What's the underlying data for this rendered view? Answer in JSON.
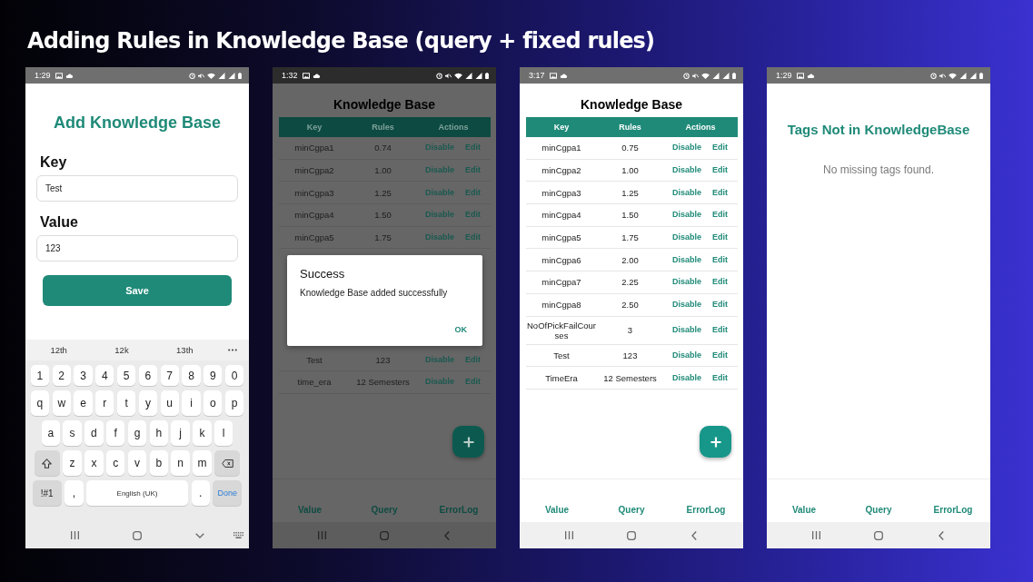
{
  "title": "Adding Rules in Knowledge Base (query + fixed rules)",
  "phones": [
    {
      "kind": "form",
      "status_bar": {
        "time": "1:29"
      },
      "heading": "Add Knowledge Base",
      "fields": [
        {
          "label": "Key",
          "value": "Test"
        },
        {
          "label": "Value",
          "value": "123"
        }
      ],
      "save_button": "Save",
      "keyboard": {
        "suggestions": [
          "12th",
          "12k",
          "13th"
        ],
        "rows": [
          {
            "keys": [
              {
                "kind": "char",
                "label": "1"
              },
              {
                "kind": "char",
                "label": "2"
              },
              {
                "kind": "char",
                "label": "3"
              },
              {
                "kind": "char",
                "label": "4"
              },
              {
                "kind": "char",
                "label": "5"
              },
              {
                "kind": "char",
                "label": "6"
              },
              {
                "kind": "char",
                "label": "7"
              },
              {
                "kind": "char",
                "label": "8"
              },
              {
                "kind": "char",
                "label": "9"
              },
              {
                "kind": "char",
                "label": "0"
              }
            ]
          },
          {
            "keys": [
              {
                "kind": "char",
                "label": "q"
              },
              {
                "kind": "char",
                "label": "w"
              },
              {
                "kind": "char",
                "label": "e"
              },
              {
                "kind": "char",
                "label": "r"
              },
              {
                "kind": "char",
                "label": "t"
              },
              {
                "kind": "char",
                "label": "y"
              },
              {
                "kind": "char",
                "label": "u"
              },
              {
                "kind": "char",
                "label": "i"
              },
              {
                "kind": "char",
                "label": "o"
              },
              {
                "kind": "char",
                "label": "p"
              }
            ]
          },
          {
            "keys": [
              {
                "kind": "char",
                "label": "a"
              },
              {
                "kind": "char",
                "label": "s"
              },
              {
                "kind": "char",
                "label": "d"
              },
              {
                "kind": "char",
                "label": "f"
              },
              {
                "kind": "char",
                "label": "g"
              },
              {
                "kind": "char",
                "label": "h"
              },
              {
                "kind": "char",
                "label": "j"
              },
              {
                "kind": "char",
                "label": "k"
              },
              {
                "kind": "char",
                "label": "l"
              }
            ]
          },
          {
            "keys": [
              {
                "kind": "shift"
              },
              {
                "kind": "char",
                "label": "z"
              },
              {
                "kind": "char",
                "label": "x"
              },
              {
                "kind": "char",
                "label": "c"
              },
              {
                "kind": "char",
                "label": "v"
              },
              {
                "kind": "char",
                "label": "b"
              },
              {
                "kind": "char",
                "label": "n"
              },
              {
                "kind": "char",
                "label": "m"
              },
              {
                "kind": "backspace"
              }
            ]
          },
          {
            "keys": [
              {
                "kind": "symbols",
                "label": "!#1"
              },
              {
                "kind": "char",
                "label": ","
              },
              {
                "kind": "space",
                "label": "English (UK)"
              },
              {
                "kind": "char",
                "label": "."
              },
              {
                "kind": "done",
                "label": "Done"
              }
            ]
          }
        ]
      }
    },
    {
      "kind": "table",
      "status_bar": {
        "time": "1:32"
      },
      "heading": "Knowledge Base",
      "table": {
        "columns": [
          "Key",
          "Rules",
          "Actions"
        ],
        "rows": [
          {
            "kind": "row",
            "key": "minCgpa1",
            "rule": "0.74",
            "actions": [
              "Disable",
              "Edit"
            ]
          },
          {
            "kind": "row",
            "key": "minCgpa2",
            "rule": "1.00",
            "actions": [
              "Disable",
              "Edit"
            ]
          },
          {
            "kind": "row",
            "key": "minCgpa3",
            "rule": "1.25",
            "actions": [
              "Disable",
              "Edit"
            ]
          },
          {
            "kind": "row",
            "key": "minCgpa4",
            "rule": "1.50",
            "actions": [
              "Disable",
              "Edit"
            ]
          },
          {
            "kind": "row",
            "key": "minCgpa5",
            "rule": "1.75",
            "actions": [
              "Disable",
              "Edit"
            ]
          },
          {
            "kind": "dialog",
            "title": "Success",
            "message": "Knowledge Base added successfully",
            "button": "OK"
          },
          {
            "kind": "row",
            "key": "Test",
            "rule": "123",
            "actions": [
              "Disable",
              "Edit"
            ]
          },
          {
            "kind": "row",
            "key": "time_era",
            "rule": "12 Semesters",
            "actions": [
              "Disable",
              "Edit"
            ]
          }
        ]
      },
      "bottom_tabs": [
        "Value",
        "Query",
        "ErrorLog"
      ]
    },
    {
      "kind": "table",
      "status_bar": {
        "time": "3:17"
      },
      "heading": "Knowledge Base",
      "table": {
        "columns": [
          "Key",
          "Rules",
          "Actions"
        ],
        "rows": [
          {
            "kind": "row",
            "key": "minCgpa1",
            "rule": "0.75",
            "actions": [
              "Disable",
              "Edit"
            ]
          },
          {
            "kind": "row",
            "key": "minCgpa2",
            "rule": "1.00",
            "actions": [
              "Disable",
              "Edit"
            ]
          },
          {
            "kind": "row",
            "key": "minCgpa3",
            "rule": "1.25",
            "actions": [
              "Disable",
              "Edit"
            ]
          },
          {
            "kind": "row",
            "key": "minCgpa4",
            "rule": "1.50",
            "actions": [
              "Disable",
              "Edit"
            ]
          },
          {
            "kind": "row",
            "key": "minCgpa5",
            "rule": "1.75",
            "actions": [
              "Disable",
              "Edit"
            ]
          },
          {
            "kind": "row",
            "key": "minCgpa6",
            "rule": "2.00",
            "actions": [
              "Disable",
              "Edit"
            ]
          },
          {
            "kind": "row",
            "key": "minCgpa7",
            "rule": "2.25",
            "actions": [
              "Disable",
              "Edit"
            ]
          },
          {
            "kind": "row",
            "key": "minCgpa8",
            "rule": "2.50",
            "actions": [
              "Disable",
              "Edit"
            ]
          },
          {
            "kind": "row",
            "key": "NoOfPickFailCourses",
            "rule": "3",
            "actions": [
              "Disable",
              "Edit"
            ]
          },
          {
            "kind": "row",
            "key": "Test",
            "rule": "123",
            "actions": [
              "Disable",
              "Edit"
            ]
          },
          {
            "kind": "row",
            "key": "TimeEra",
            "rule": "12 Semesters",
            "actions": [
              "Disable",
              "Edit"
            ]
          }
        ]
      },
      "bottom_tabs": [
        "Value",
        "Query",
        "ErrorLog"
      ]
    },
    {
      "kind": "message",
      "status_bar": {
        "time": "1:29"
      },
      "heading": "Tags Not in KnowledgeBase",
      "message": "No missing tags found.",
      "bottom_tabs": [
        "Value",
        "Query",
        "ErrorLog"
      ]
    }
  ]
}
